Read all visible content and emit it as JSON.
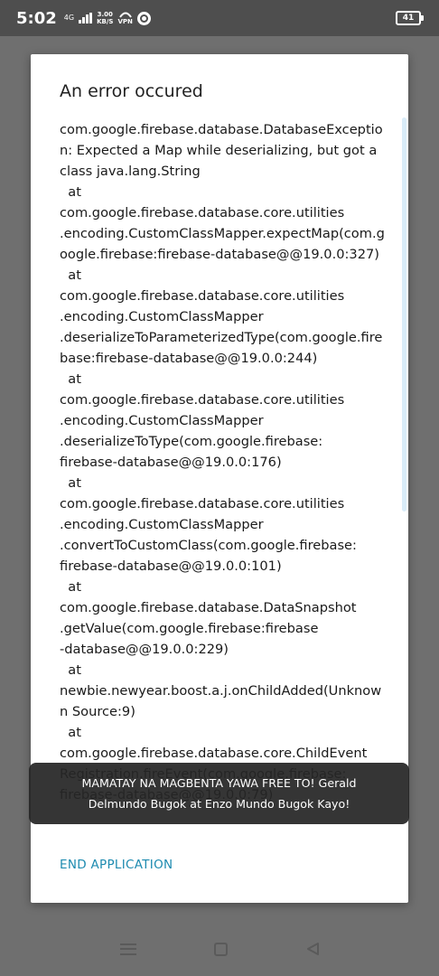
{
  "status_bar": {
    "time": "5:02",
    "network": "4G",
    "speed_value": "3.00",
    "speed_unit": "KB/S",
    "vpn": "VPN",
    "battery": "41"
  },
  "dialog": {
    "title": "An error occured",
    "message": "com.google.firebase.database.DatabaseException: Expected a Map while deserializing, but got a class java.lang.String\n  at\ncom.google.firebase.database.core.utilities\n.encoding.CustomClassMapper.expectMap(com.google.firebase:firebase-database@@19.0.0:327)\n  at\ncom.google.firebase.database.core.utilities\n.encoding.CustomClassMapper\n.deserializeToParameterizedType(com.google.firebase:firebase-database@@19.0.0:244)\n  at\ncom.google.firebase.database.core.utilities\n.encoding.CustomClassMapper\n.deserializeToType(com.google.firebase:\nfirebase-database@@19.0.0:176)\n  at\ncom.google.firebase.database.core.utilities\n.encoding.CustomClassMapper\n.convertToCustomClass(com.google.firebase:\nfirebase-database@@19.0.0:101)\n  at\ncom.google.firebase.database.DataSnapshot\n.getValue(com.google.firebase:firebase\n-database@@19.0.0:229)\n  at\nnewbie.newyear.boost.a.j.onChildAdded(Unknown Source:9)\n  at\ncom.google.firebase.database.core.ChildEvent\nRegistration.fireEvent(com.google.firebase:\nfirebase-database@@19.0.0:79)",
    "end_button_label": "END APPLICATION"
  },
  "toast": {
    "line1": "MAMATAY NA MAGBENTA YAWA FREE TO! Gerald",
    "line2": "Delmundo Bugok at Enzo Mundo Bugok Kayo!"
  },
  "colors": {
    "accent": "#1e8bb0",
    "scrim": "#6f6f6f",
    "status_bar": "#4e4e4e"
  },
  "icons": [
    "signal-bars-icon",
    "vpn-icon",
    "circle-app-icon",
    "battery-icon",
    "menu-icon",
    "home-icon",
    "back-icon"
  ]
}
